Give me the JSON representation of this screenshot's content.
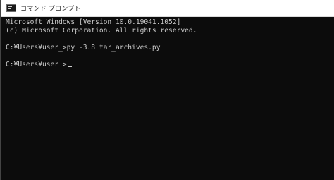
{
  "window": {
    "title": "コマンド プロンプト",
    "icon": "cmd-icon"
  },
  "console": {
    "lines": [
      "Microsoft Windows [Version 10.0.19041.1052]",
      "(c) Microsoft Corporation. All rights reserved.",
      "",
      "C:¥Users¥user_>py -3.8 tar_archives.py",
      "",
      "C:¥Users¥user_>"
    ]
  },
  "colors": {
    "background": "#0c0c0c",
    "text": "#cccccc",
    "titlebar": "#ffffff"
  }
}
